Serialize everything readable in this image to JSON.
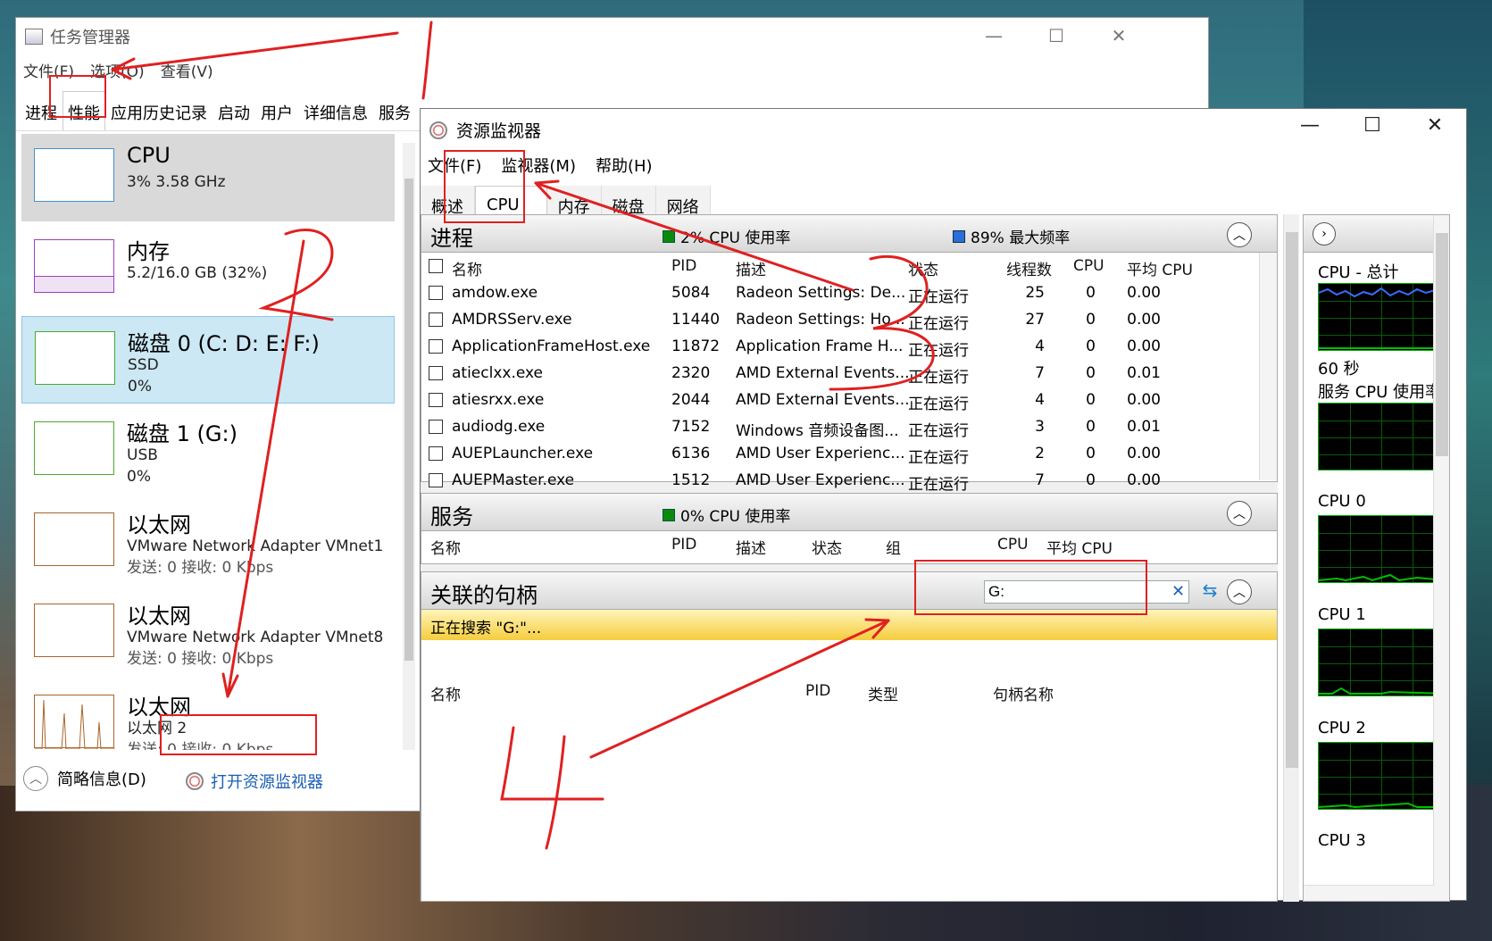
{
  "task_manager": {
    "title": "任务管理器",
    "menu": [
      "文件(F)",
      "选项(O)",
      "查看(V)"
    ],
    "tabs": [
      "进程",
      "性能",
      "应用历史记录",
      "启动",
      "用户",
      "详细信息",
      "服务"
    ],
    "active_tab": "性能",
    "perf_items": [
      {
        "title": "CPU",
        "line1": "3%  3.58 GHz",
        "line2": ""
      },
      {
        "title": "内存",
        "line1": "5.2/16.0 GB (32%)",
        "line2": ""
      },
      {
        "title": "磁盘 0 (C: D: E: F:)",
        "line1": "SSD",
        "line2": "0%"
      },
      {
        "title": "磁盘 1 (G:)",
        "line1": "USB",
        "line2": "0%"
      },
      {
        "title": "以太网",
        "line1": "VMware Network Adapter VMnet1",
        "line2": "发送: 0 接收: 0 Kbps"
      },
      {
        "title": "以太网",
        "line1": "VMware Network Adapter VMnet8",
        "line2": "发送: 0 接收: 0 Kbps"
      },
      {
        "title": "以太网",
        "line1": "以太网 2",
        "line2": "发送: 0 接收: 0 Kbps"
      }
    ],
    "footer_less": "简略信息(D)",
    "footer_open": "打开资源监视器"
  },
  "resource_monitor": {
    "title": "资源监视器",
    "menu": [
      "文件(F)",
      "监视器(M)",
      "帮助(H)"
    ],
    "tabs": [
      "概述",
      "CPU",
      "内存",
      "磁盘",
      "网络"
    ],
    "active_tab": "CPU",
    "processes": {
      "title": "进程",
      "cpu_usage": "2% CPU 使用率",
      "max_freq": "89% 最大频率",
      "columns": [
        "名称",
        "PID",
        "描述",
        "状态",
        "线程数",
        "CPU",
        "平均 CPU"
      ],
      "rows": [
        [
          "amdow.exe",
          "5084",
          "Radeon Settings: De...",
          "正在运行",
          "25",
          "0",
          "0.00"
        ],
        [
          "AMDRSServ.exe",
          "11440",
          "Radeon Settings: Ho...",
          "正在运行",
          "27",
          "0",
          "0.00"
        ],
        [
          "ApplicationFrameHost.exe",
          "11872",
          "Application Frame H...",
          "正在运行",
          "4",
          "0",
          "0.00"
        ],
        [
          "atieclxx.exe",
          "2320",
          "AMD External Events...",
          "正在运行",
          "7",
          "0",
          "0.01"
        ],
        [
          "atiesrxx.exe",
          "2044",
          "AMD External Events...",
          "正在运行",
          "4",
          "0",
          "0.00"
        ],
        [
          "audiodg.exe",
          "7152",
          "Windows 音频设备图...",
          "正在运行",
          "3",
          "0",
          "0.01"
        ],
        [
          "AUEPLauncher.exe",
          "6136",
          "AMD User Experienc...",
          "正在运行",
          "2",
          "0",
          "0.00"
        ],
        [
          "AUEPMaster.exe",
          "1512",
          "AMD User Experienc...",
          "正在运行",
          "7",
          "0",
          "0.00"
        ]
      ]
    },
    "services": {
      "title": "服务",
      "cpu_usage": "0% CPU 使用率",
      "columns": [
        "名称",
        "PID",
        "描述",
        "状态",
        "组",
        "CPU",
        "平均 CPU"
      ]
    },
    "handles": {
      "title": "关联的句柄",
      "search_value": "G:",
      "search_status": "正在搜索 \"G:\"...",
      "columns": [
        "名称",
        "PID",
        "类型",
        "句柄名称"
      ]
    },
    "right_panel": {
      "total_label": "CPU - 总计",
      "seconds": "60 秒",
      "service_usage": "服务 CPU 使用率",
      "cpus": [
        "CPU 0",
        "CPU 1",
        "CPU 2",
        "CPU 3"
      ]
    }
  },
  "annotations": [
    "2",
    "3",
    "4"
  ],
  "colors": {
    "annotation_red": "#e02020",
    "search_bar": "#f5cd3e",
    "graph_green": "#00c000"
  }
}
